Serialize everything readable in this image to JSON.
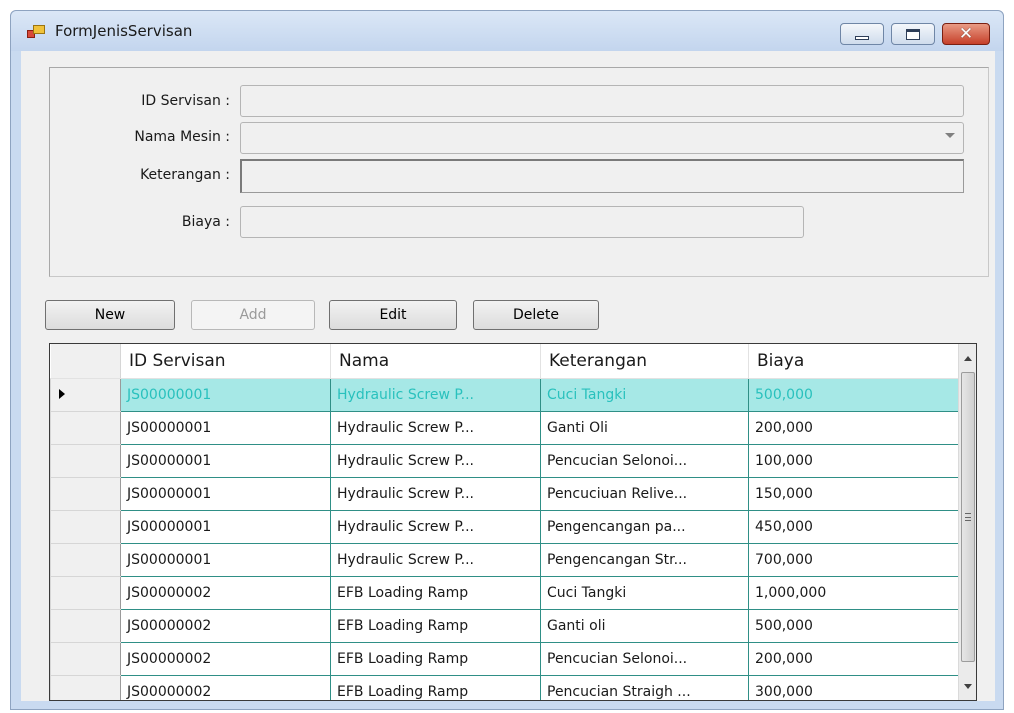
{
  "window": {
    "title": "FormJenisServisan",
    "min_icon": "minimize-icon",
    "max_icon": "maximize-icon",
    "close_icon": "close-icon"
  },
  "form": {
    "id_label": "ID Servisan :",
    "id_value": "",
    "nama_label": "Nama Mesin :",
    "nama_value": "",
    "keterangan_label": "Keterangan :",
    "keterangan_value": "",
    "biaya_label": "Biaya :",
    "biaya_value": ""
  },
  "buttons": {
    "new": "New",
    "add": "Add",
    "edit": "Edit",
    "delete": "Delete"
  },
  "grid": {
    "columns": [
      "ID Servisan",
      "Nama",
      "Keterangan",
      "Biaya"
    ],
    "rows": [
      [
        "JS00000001",
        "Hydraulic Screw P...",
        "Cuci Tangki",
        "500,000"
      ],
      [
        "JS00000001",
        "Hydraulic Screw P...",
        "Ganti Oli",
        "200,000"
      ],
      [
        "JS00000001",
        "Hydraulic Screw P...",
        "Pencucian Selonoi...",
        "100,000"
      ],
      [
        "JS00000001",
        "Hydraulic Screw P...",
        "Pencuciuan Relive...",
        "150,000"
      ],
      [
        "JS00000001",
        "Hydraulic Screw P...",
        "Pengencangan pa...",
        "450,000"
      ],
      [
        "JS00000001",
        "Hydraulic Screw P...",
        "Pengencangan Str...",
        "700,000"
      ],
      [
        "JS00000002",
        "EFB Loading Ramp",
        "Cuci Tangki",
        "1,000,000"
      ],
      [
        "JS00000002",
        "EFB Loading Ramp",
        "Ganti oli",
        "500,000"
      ],
      [
        "JS00000002",
        "EFB Loading Ramp",
        "Pencucian Selonoi...",
        "200,000"
      ],
      [
        "JS00000002",
        "EFB Loading Ramp",
        "Pencucian Straigh ...",
        "300,000"
      ]
    ],
    "selected_row": 0
  },
  "colors": {
    "selection_bg": "#a6e8e6",
    "selection_text": "#29c1bd",
    "grid_line": "#2f8f86"
  }
}
